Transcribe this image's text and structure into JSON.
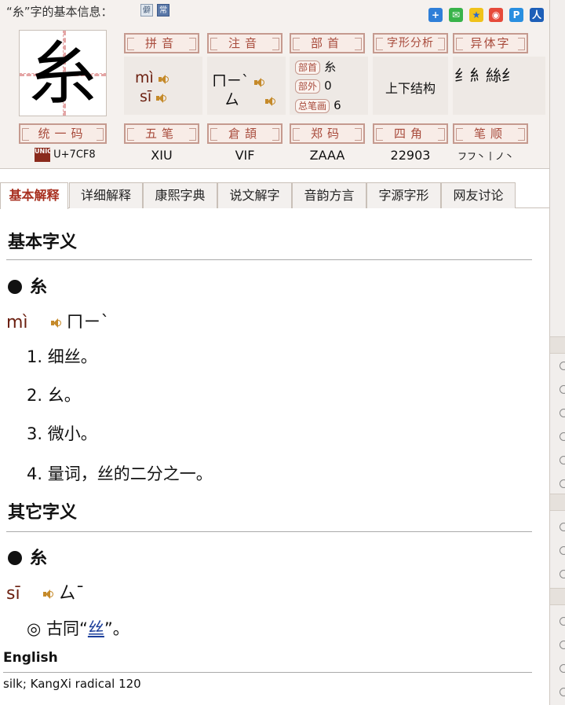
{
  "header": {
    "title": "“糸”字的基本信息：",
    "tag_rare": "僻",
    "tag_common": "常",
    "share_icons": [
      "plus-icon",
      "wechat-icon",
      "qzone-icon",
      "weibo-icon",
      "pengyou-icon",
      "renren-icon"
    ]
  },
  "character": "糸",
  "labels": {
    "pinyin": "拼音",
    "zhuyin": "注音",
    "bushou": "部首",
    "structure": "字形分析",
    "variant": "异体字",
    "unicode": "统一码",
    "wubi": "五笔",
    "cangjie": "倉頡",
    "zhengma": "郑码",
    "sijiao": "四角",
    "bishun": "笔顺"
  },
  "pinyin": [
    "mì",
    "sī"
  ],
  "zhuyin": [
    "ㄇㄧˋ",
    "ㄙ"
  ],
  "bushou": {
    "radical_label": "部首",
    "radical": "糸",
    "outer_label": "部外",
    "outer": "0",
    "total_label": "总笔画",
    "total": "6"
  },
  "structure": "上下结构",
  "variants": "纟⺯絲纟",
  "codes": {
    "unicode": "U+7CF8",
    "unicode_logo": "UNICODE",
    "wubi": "XIU",
    "cangjie": "VIF",
    "zhengma": "ZAAA",
    "sijiao": "22903",
    "bishun": "フフ丶丨ノ丶"
  },
  "tabs": [
    {
      "label": "基本解释",
      "active": true
    },
    {
      "label": "详细解释"
    },
    {
      "label": "康熙字典"
    },
    {
      "label": "说文解字"
    },
    {
      "label": "音韵方言"
    },
    {
      "label": "字源字形"
    },
    {
      "label": "网友讨论"
    }
  ],
  "basic": {
    "heading": "基本字义",
    "char": "糸",
    "pinyin": "mì",
    "zhuyin": "ㄇㄧˋ",
    "defs": [
      "1. 细丝。",
      "2. 幺。",
      "3. 微小。",
      "4. 量词，丝的二分之一。"
    ]
  },
  "other": {
    "heading": "其它字义",
    "char": "糸",
    "pinyin": "sī",
    "zhuyin": "ㄙˉ",
    "def_prefix": "◎ 古同“",
    "def_link": "丝",
    "def_suffix": "”。"
  },
  "english": {
    "heading": "English",
    "text": "silk; KangXi radical 120"
  }
}
